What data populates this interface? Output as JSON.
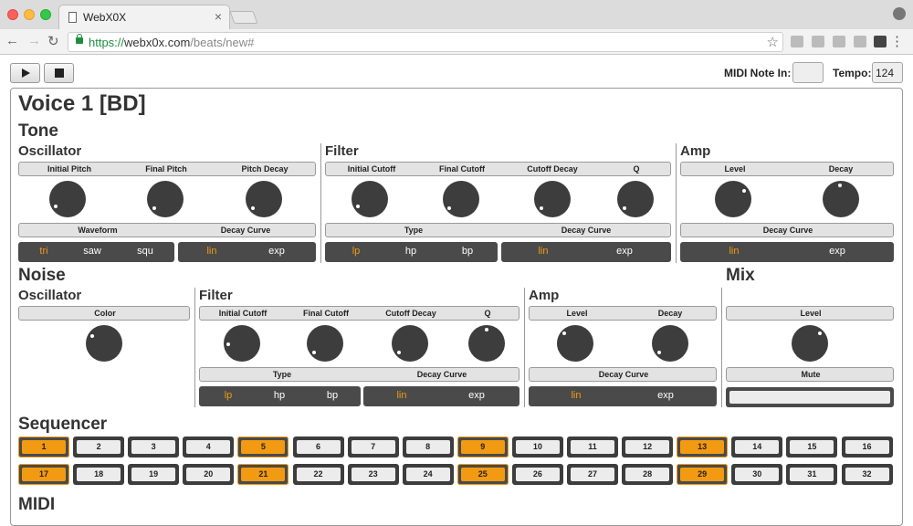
{
  "browser": {
    "tab_title": "WebX0X",
    "tab_close": "×",
    "url_scheme": "https://",
    "url_host": "webx0x.com",
    "url_path": "/beats/new#"
  },
  "transport": {
    "midi_label": "MIDI Note In:",
    "midi_value": "",
    "tempo_label": "Tempo:",
    "tempo_value": "124"
  },
  "voice_title": "Voice 1 [BD]",
  "tone": {
    "heading": "Tone",
    "oscillator": {
      "heading": "Oscillator",
      "params": [
        "Initial Pitch",
        "Final Pitch",
        "Pitch Decay"
      ],
      "row2": [
        "Waveform",
        "Decay Curve"
      ],
      "waveform": [
        "tri",
        "saw",
        "squ"
      ],
      "curve": [
        "lin",
        "exp"
      ]
    },
    "filter": {
      "heading": "Filter",
      "params": [
        "Initial Cutoff",
        "Final Cutoff",
        "Cutoff Decay",
        "Q"
      ],
      "row2": [
        "Type",
        "Decay Curve"
      ],
      "type": [
        "lp",
        "hp",
        "bp"
      ],
      "curve": [
        "lin",
        "exp"
      ]
    },
    "amp": {
      "heading": "Amp",
      "params": [
        "Level",
        "Decay"
      ],
      "row2": [
        "Decay Curve"
      ],
      "curve": [
        "lin",
        "exp"
      ]
    }
  },
  "noise": {
    "heading": "Noise",
    "oscillator": {
      "heading": "Oscillator",
      "params": [
        "Color"
      ]
    },
    "filter": {
      "heading": "Filter",
      "params": [
        "Initial Cutoff",
        "Final Cutoff",
        "Cutoff Decay",
        "Q"
      ],
      "row2": [
        "Type",
        "Decay Curve"
      ],
      "type": [
        "lp",
        "hp",
        "bp"
      ],
      "curve": [
        "lin",
        "exp"
      ]
    },
    "amp": {
      "heading": "Amp",
      "params": [
        "Level",
        "Decay"
      ],
      "row2": [
        "Decay Curve"
      ],
      "curve": [
        "lin",
        "exp"
      ]
    }
  },
  "mix": {
    "heading": "Mix",
    "params": [
      "Level"
    ],
    "row2": [
      "Mute"
    ]
  },
  "sequencer": {
    "heading": "Sequencer",
    "steps": [
      "1",
      "2",
      "3",
      "4",
      "5",
      "6",
      "7",
      "8",
      "9",
      "10",
      "11",
      "12",
      "13",
      "14",
      "15",
      "16",
      "17",
      "18",
      "19",
      "20",
      "21",
      "22",
      "23",
      "24",
      "25",
      "26",
      "27",
      "28",
      "29",
      "30",
      "31",
      "32"
    ],
    "active": [
      1,
      5,
      9,
      13,
      17,
      21,
      25,
      29
    ]
  },
  "midi_heading": "MIDI",
  "colors": {
    "accent": "#f29a12",
    "control": "#4a4a4a",
    "knob": "#3d3d3d"
  }
}
